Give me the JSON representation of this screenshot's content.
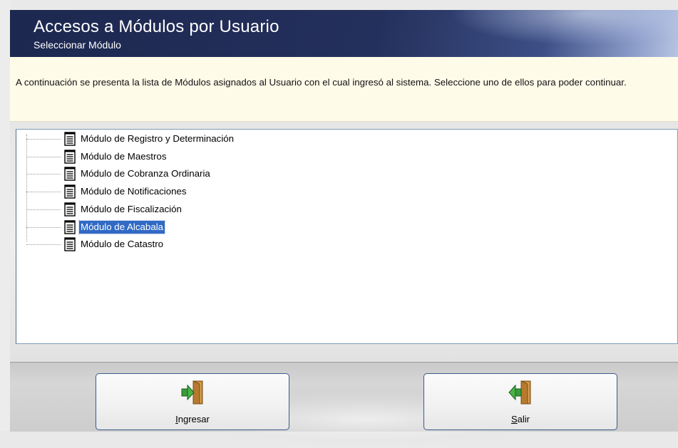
{
  "header": {
    "title": "Accesos a Módulos por Usuario",
    "subtitle": "Seleccionar Módulo"
  },
  "info": {
    "text": "A continuación se presenta la lista de Módulos asignados al Usuario con el cual ingresó al sistema. Seleccione uno de ellos para poder continuar."
  },
  "tree": {
    "items": [
      {
        "label": "Módulo de Registro y Determinación",
        "selected": false
      },
      {
        "label": "Módulo de Maestros",
        "selected": false
      },
      {
        "label": "Módulo de Cobranza Ordinaria",
        "selected": false
      },
      {
        "label": "Módulo de Notificaciones",
        "selected": false
      },
      {
        "label": "Módulo de Fiscalización",
        "selected": false
      },
      {
        "label": "Módulo de Alcabala",
        "selected": true
      },
      {
        "label": "Módulo de Catastro",
        "selected": false
      }
    ],
    "icon": "document-icon",
    "selection_color": "#316ac5"
  },
  "footer": {
    "ingresar": {
      "mnemonic": "I",
      "rest": "ngresar",
      "icon": "door-enter-icon"
    },
    "salir": {
      "mnemonic": "S",
      "rest": "alir",
      "icon": "door-exit-icon"
    }
  },
  "colors": {
    "header_bg": "#1d2850",
    "info_bg": "#fffbe9",
    "button_border": "#3c5a8a"
  }
}
